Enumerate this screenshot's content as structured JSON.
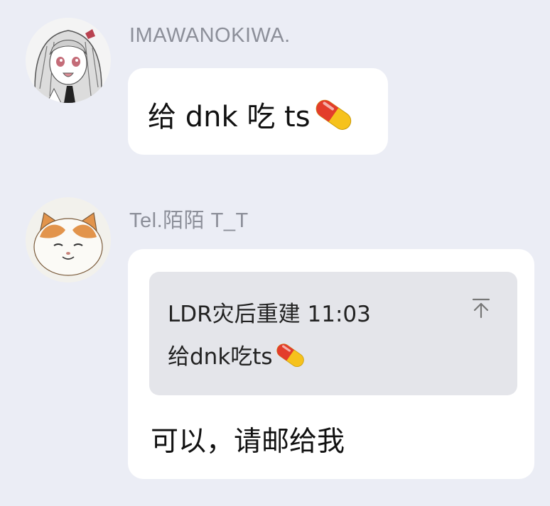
{
  "messages": [
    {
      "sender": "IMAWANOKIWA.",
      "text": "给 dnk 吃 ts",
      "emoji_icon": "pill-icon"
    },
    {
      "sender": "Tel.陌陌 T_T",
      "quote": {
        "author_time": "LDR灾后重建 11:03",
        "text": "给dnk吃ts",
        "emoji_icon": "pill-icon",
        "jump_icon": "jump-to-top-icon"
      },
      "text": "可以，请邮给我"
    }
  ],
  "colors": {
    "background": "#ebedf5",
    "bubble": "#ffffff",
    "quote_background": "#e4e5ea",
    "sender_name": "#8c8f99",
    "pill_red": "#e33d2b",
    "pill_yellow": "#f6c21c"
  }
}
